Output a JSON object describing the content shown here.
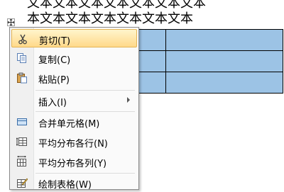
{
  "document": {
    "text_line_top": "文本文本文本文本文本文本文本",
    "text_line": "本文本文本文本文本文本文本"
  },
  "context_menu": {
    "items": [
      {
        "label": "剪切(T)",
        "icon": "scissors-icon",
        "highlighted": true
      },
      {
        "label": "复制(C)",
        "icon": "copy-icon"
      },
      {
        "label": "粘贴(P)",
        "icon": "paste-icon"
      },
      {
        "label": "插入(I)",
        "icon": "",
        "submenu": true
      },
      {
        "label": "合并单元格(M)",
        "icon": "merge-cells-icon"
      },
      {
        "label": "平均分布各行(N)",
        "icon": "distribute-rows-icon"
      },
      {
        "label": "平均分布各列(Y)",
        "icon": "distribute-columns-icon"
      },
      {
        "label": "绘制表格(W)",
        "icon": "draw-table-icon"
      }
    ]
  },
  "colors": {
    "cell_selected": "#9cc3e5",
    "menu_highlight": "#ffd98a"
  }
}
